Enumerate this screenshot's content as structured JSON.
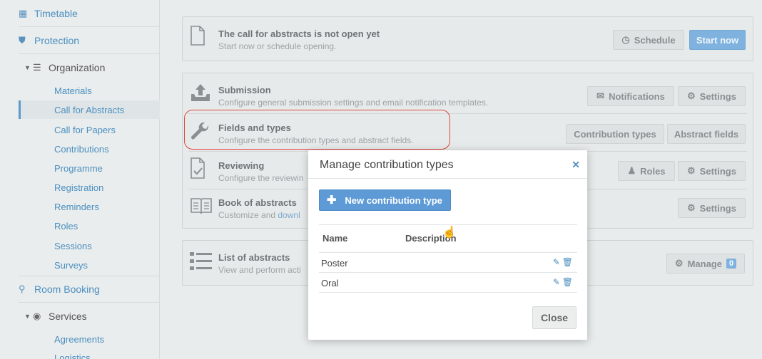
{
  "sidebar": {
    "timetable": "Timetable",
    "protection": "Protection",
    "organization": "Organization",
    "org_items": [
      "Materials",
      "Call for Abstracts",
      "Call for Papers",
      "Contributions",
      "Programme",
      "Registration",
      "Reminders",
      "Roles",
      "Sessions",
      "Surveys"
    ],
    "room_booking": "Room Booking",
    "services": "Services",
    "service_items": [
      "Agreements",
      "Logistics"
    ]
  },
  "call_status": {
    "title": "The call for abstracts is not open yet",
    "subtitle": "Start now or schedule opening.",
    "schedule_label": "Schedule",
    "start_label": "Start now"
  },
  "sections": {
    "submission": {
      "title": "Submission",
      "subtitle": "Configure general submission settings and email notification templates.",
      "notifications_label": "Notifications",
      "settings_label": "Settings"
    },
    "fields": {
      "title": "Fields and types",
      "subtitle": "Configure the contribution types and abstract fields.",
      "types_label": "Contribution types",
      "fields_label": "Abstract fields"
    },
    "reviewing": {
      "title": "Reviewing",
      "subtitle": "Configure the reviewin",
      "roles_label": "Roles",
      "settings_label": "Settings"
    },
    "book": {
      "title": "Book of abstracts",
      "subtitle_a": "Customize and ",
      "subtitle_link": "downl",
      "settings_label": "Settings"
    },
    "list": {
      "title": "List of abstracts",
      "subtitle": "View and perform acti",
      "manage_label": "Manage",
      "manage_count": "0"
    }
  },
  "modal": {
    "title": "Manage contribution types",
    "new_label": "New contribution type",
    "col_name": "Name",
    "col_description": "Description",
    "rows": [
      {
        "name": "Poster",
        "description": ""
      },
      {
        "name": "Oral",
        "description": ""
      }
    ],
    "close_label": "Close"
  }
}
